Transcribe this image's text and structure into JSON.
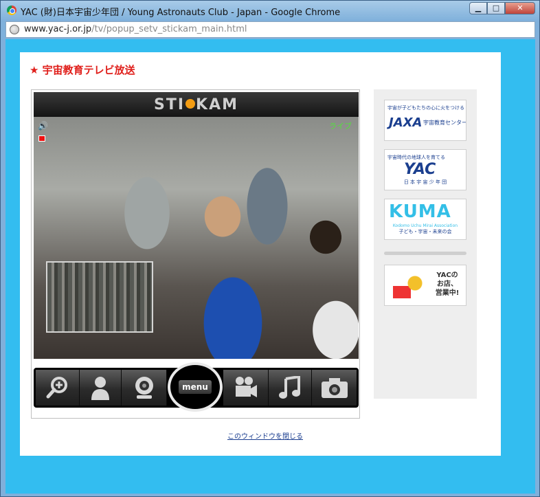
{
  "window": {
    "title": "YAC (財)日本宇宙少年団 / Young Astronauts Club - Japan - Google Chrome",
    "controls": {
      "minimize": "▁",
      "maximize": "□",
      "close": "✕"
    }
  },
  "address": {
    "host": "www.yac-j.or.jp",
    "path": "/tv/popup_setv_stickam_main.html"
  },
  "page": {
    "heading": "★ 宇宙教育テレビ放送",
    "player": {
      "brand_left": "STI",
      "brand_right": "KAM",
      "live_label": "ライブ",
      "sound_icon": "🔊",
      "controls": {
        "zoom": "zoom-in-icon",
        "menu_label": "menu"
      }
    },
    "sidebar": {
      "jaxa": {
        "sub": "宇宙が子どもたちの心に火をつける",
        "main": "JAXA",
        "side": "宇宙教育センター"
      },
      "yac": {
        "sub": "宇宙時代の地球人を育てる",
        "main": "YAC",
        "bottom": "日 本 宇 宙 少 年 団"
      },
      "kuma": {
        "main": "KUMA",
        "sub": "Kodomo Uchu Mirai Association",
        "bottom": "子ども・宇宙・未来の会"
      },
      "shop": {
        "line1": "YACの",
        "line2": "お店、",
        "line3": "営業中!"
      }
    },
    "close_link": "このウィンドウを閉じる"
  }
}
